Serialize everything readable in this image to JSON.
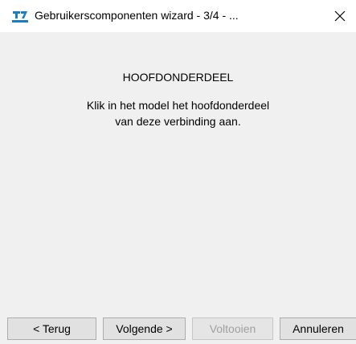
{
  "window": {
    "title": "Gebruikerscomponenten wizard - 3/4 - ...",
    "app_icon": "tekla-app-icon",
    "close_glyph": "✕"
  },
  "content": {
    "heading": "HOOFDONDERDEEL",
    "instruction_line1": "Klik in het model het hoofdonderdeel",
    "instruction_line2": "van deze verbinding aan."
  },
  "buttons": {
    "back": "< Terug",
    "next": "Volgende >",
    "finish": "Voltooien",
    "cancel": "Annuleren"
  },
  "colors": {
    "titlebar": "#ffffff",
    "dialog_bg": "#f0f0f0",
    "button_bg": "#e1e1e1",
    "disabled_text": "#a0a0a0",
    "icon_blue": "#1a7fc1"
  }
}
